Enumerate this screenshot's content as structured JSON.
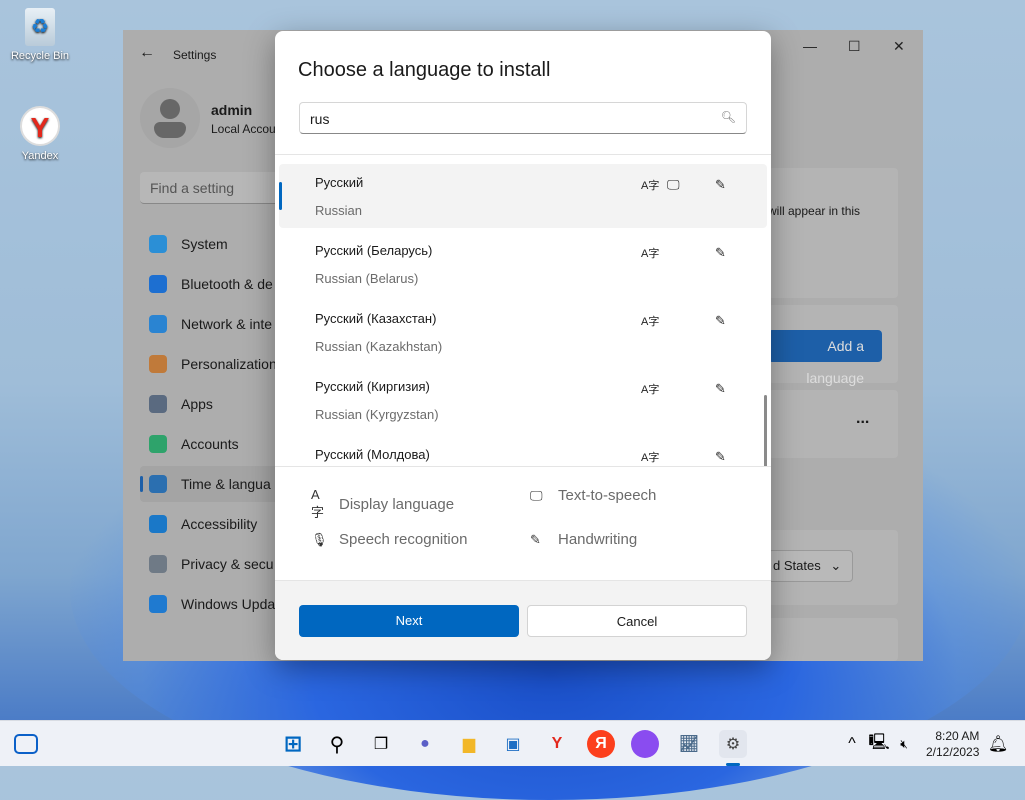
{
  "desktop": {
    "icons": [
      {
        "label": "Recycle Bin",
        "icon": "recycle-bin-icon"
      },
      {
        "label": "Yandex",
        "icon": "yandex-browser-icon"
      }
    ]
  },
  "settings": {
    "title": "Settings",
    "user": {
      "name": "admin",
      "type": "Local Accou"
    },
    "search_placeholder": "Find a setting",
    "nav": [
      {
        "label": "System",
        "color": "#2b8fd6"
      },
      {
        "label": "Bluetooth & de",
        "color": "#1d6fd1"
      },
      {
        "label": "Network & inte",
        "color": "#2a84d2"
      },
      {
        "label": "Personalization",
        "color": "#c07a3a"
      },
      {
        "label": "Apps",
        "color": "#5a6a80"
      },
      {
        "label": "Accounts",
        "color": "#2ea36b"
      },
      {
        "label": "Time & langua",
        "color": "#2b6fb0"
      },
      {
        "label": "Accessibility",
        "color": "#1a78c8"
      },
      {
        "label": "Privacy & secu",
        "color": "#6f7a86"
      },
      {
        "label": "Windows Upda",
        "color": "#1f7ad0"
      }
    ],
    "selected_nav": "Time & langua",
    "content": {
      "hint": "will appear in this",
      "add_language": "Add a language",
      "more": "...",
      "region": "d States"
    }
  },
  "dialog": {
    "title": "Choose a language to install",
    "search_value": "rus",
    "languages": [
      {
        "name": "Русский",
        "english": "Russian",
        "display": true,
        "tts": true,
        "handwriting": true,
        "selected": true
      },
      {
        "name": "Русский (Беларусь)",
        "english": "Russian (Belarus)",
        "display": true,
        "tts": false,
        "handwriting": true
      },
      {
        "name": "Русский (Казахстан)",
        "english": "Russian (Kazakhstan)",
        "display": true,
        "tts": false,
        "handwriting": true
      },
      {
        "name": "Русский (Киргизия)",
        "english": "Russian (Kyrgyzstan)",
        "display": true,
        "tts": false,
        "handwriting": true
      },
      {
        "name": "Русский (Молдова)",
        "english": "",
        "display": true,
        "tts": false,
        "handwriting": true
      }
    ],
    "legend": {
      "display": "Display language",
      "tts": "Text-to-speech",
      "speech": "Speech recognition",
      "handwriting": "Handwriting"
    },
    "next": "Next",
    "cancel": "Cancel"
  },
  "taskbar": {
    "time": "8:20 AM",
    "date": "2/12/2023",
    "accent": "#0067c0"
  }
}
